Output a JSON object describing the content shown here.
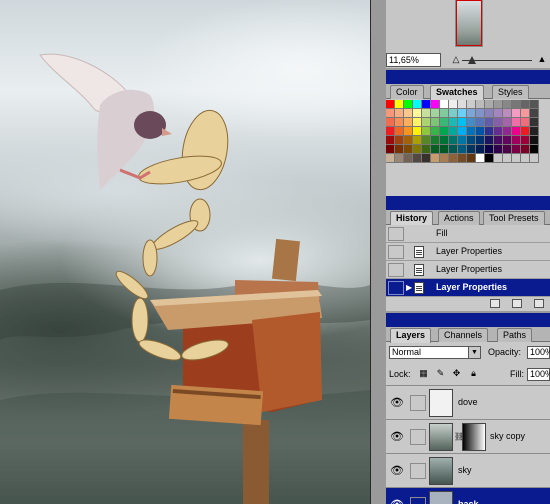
{
  "navigator": {
    "zoom_value": "11,65%"
  },
  "swatches": {
    "tabs": [
      {
        "label": "Color",
        "active": false
      },
      {
        "label": "Swatches",
        "active": true
      },
      {
        "label": "Styles",
        "active": false
      }
    ],
    "colors": [
      "#ff0000",
      "#ffff00",
      "#00ff00",
      "#00ffff",
      "#0000ff",
      "#ff00ff",
      "#ffffff",
      "#eeeeee",
      "#dddddd",
      "#cccccc",
      "#bbbbbb",
      "#aaaaaa",
      "#999999",
      "#888888",
      "#777777",
      "#666666",
      "#555555",
      "#f7977a",
      "#fbad82",
      "#fdc68c",
      "#fff799",
      "#c6df9c",
      "#a4d49d",
      "#81ca9d",
      "#7bcdc9",
      "#6ccff7",
      "#7ca6d8",
      "#8293ca",
      "#8881be",
      "#a286bd",
      "#bc8cbf",
      "#f49bc1",
      "#f5999d",
      "#444444",
      "#f26c4f",
      "#f68e56",
      "#fbaf5c",
      "#fff467",
      "#acd372",
      "#7cc576",
      "#3bb878",
      "#1abbb4",
      "#00bff3",
      "#438ccb",
      "#5574b9",
      "#605ca9",
      "#855fa8",
      "#a763a9",
      "#ef6ea8",
      "#f16d7e",
      "#333333",
      "#ee1d24",
      "#f16522",
      "#f7941d",
      "#fff200",
      "#8fc63d",
      "#37b44a",
      "#00a650",
      "#00a99e",
      "#00aeef",
      "#0072bc",
      "#0054a5",
      "#2f3192",
      "#652c91",
      "#91278f",
      "#ec008c",
      "#ed1c24",
      "#222222",
      "#9d0a0e",
      "#a0410d",
      "#a36209",
      "#aba000",
      "#588528",
      "#197b30",
      "#007236",
      "#00736a",
      "#0076a4",
      "#004a80",
      "#003370",
      "#1d1363",
      "#450e61",
      "#62055f",
      "#9e005c",
      "#9d0039",
      "#111111",
      "#790000",
      "#7b3000",
      "#7c4900",
      "#827a00",
      "#3e6617",
      "#045f20",
      "#005824",
      "#005951",
      "#005b7e",
      "#003562",
      "#002056",
      "#0c004b",
      "#30004a",
      "#4b0048",
      "#7a0045",
      "#7a0026",
      "#000000",
      "#c7b299",
      "#998675",
      "#736357",
      "#534741",
      "#37302d",
      "#c69c6d",
      "#a67c52",
      "#8c6239",
      "#754c24",
      "#603913",
      "#ffffff",
      "#000000",
      "#c9c9c9",
      "#c9c9c9",
      "#c9c9c9",
      "#c9c9c9",
      "#c9c9c9"
    ]
  },
  "history": {
    "tabs": [
      {
        "label": "History",
        "active": true
      },
      {
        "label": "Actions",
        "active": false
      },
      {
        "label": "Tool Presets",
        "active": false
      }
    ],
    "items": [
      {
        "label": "Fill",
        "selected": false
      },
      {
        "label": "Layer Properties",
        "selected": false
      },
      {
        "label": "Layer Properties",
        "selected": false
      },
      {
        "label": "Layer Properties",
        "selected": true
      }
    ]
  },
  "layers": {
    "tabs": [
      {
        "label": "Layers",
        "active": true
      },
      {
        "label": "Channels",
        "active": false
      },
      {
        "label": "Paths",
        "active": false
      }
    ],
    "blend_mode": "Normal",
    "opacity_label": "Opacity:",
    "opacity_value": "100%",
    "lock_label": "Lock:",
    "fill_label": "Fill:",
    "fill_value": "100%",
    "items": [
      {
        "name": "dove",
        "has_mask": false,
        "selected": false
      },
      {
        "name": "sky copy",
        "has_mask": true,
        "selected": false
      },
      {
        "name": "sky",
        "has_mask": false,
        "selected": false
      },
      {
        "name": "back",
        "has_mask": false,
        "selected": true
      }
    ]
  }
}
